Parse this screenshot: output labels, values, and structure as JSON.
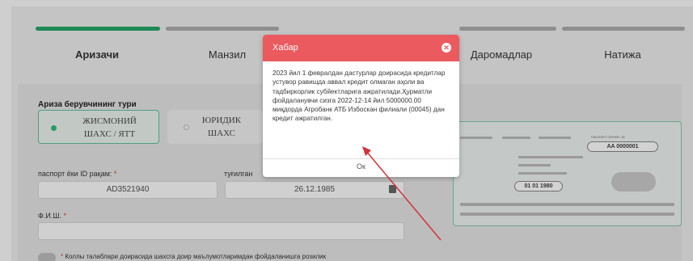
{
  "steps": [
    {
      "label": "Аризачи",
      "active": true
    },
    {
      "label": "Манзил",
      "active": false
    },
    {
      "label": "",
      "active": false
    },
    {
      "label": "Даромадлар",
      "active": false
    },
    {
      "label": "Натижа",
      "active": false
    }
  ],
  "applicant_type": {
    "title": "Ариза берувчининг тури",
    "options": [
      {
        "line1": "ЖИСМОНИЙ",
        "line2": "ШАХС / ЯТТ",
        "selected": true
      },
      {
        "line1": "ЮРИДИК",
        "line2": "ШАХС",
        "selected": false
      }
    ]
  },
  "fields": {
    "passport_label": "паспорт ёки ID рақам:",
    "passport_value": "AD3521940",
    "birth_label": "туғилган",
    "birth_value": "26.12.1985",
    "fio_label": "Ф.И.Ш.",
    "required_mark": "*"
  },
  "passport_card": {
    "series": "AA 0000001",
    "date": "01 01 1980",
    "caption": "ПАСПОРТ СЕРИЯ / ID"
  },
  "consent_text": "Коллы талаблари доирасида шахсга доир маълумотларимдан фойдаланишга розилик",
  "modal": {
    "title": "Хабар",
    "body": "2023 йил 1 февралдан дастурлар доирасида кредитлар устувор равишда аввал кредит олмаган аҳоли ва тадбиркорлик субйектларига ажратилади.Ҳурматли фойдаланувчи сизга 2022-12-14 йил 5000000.00 миқдорда Агробанк АТБ Избоскан филиали (00045) дан кредит ажратилган.",
    "ok_label": "Ок"
  },
  "colors": {
    "active_step": "#1e8a57",
    "modal_header": "#ea5a5e",
    "annotation_arrow": "#d0333a"
  }
}
